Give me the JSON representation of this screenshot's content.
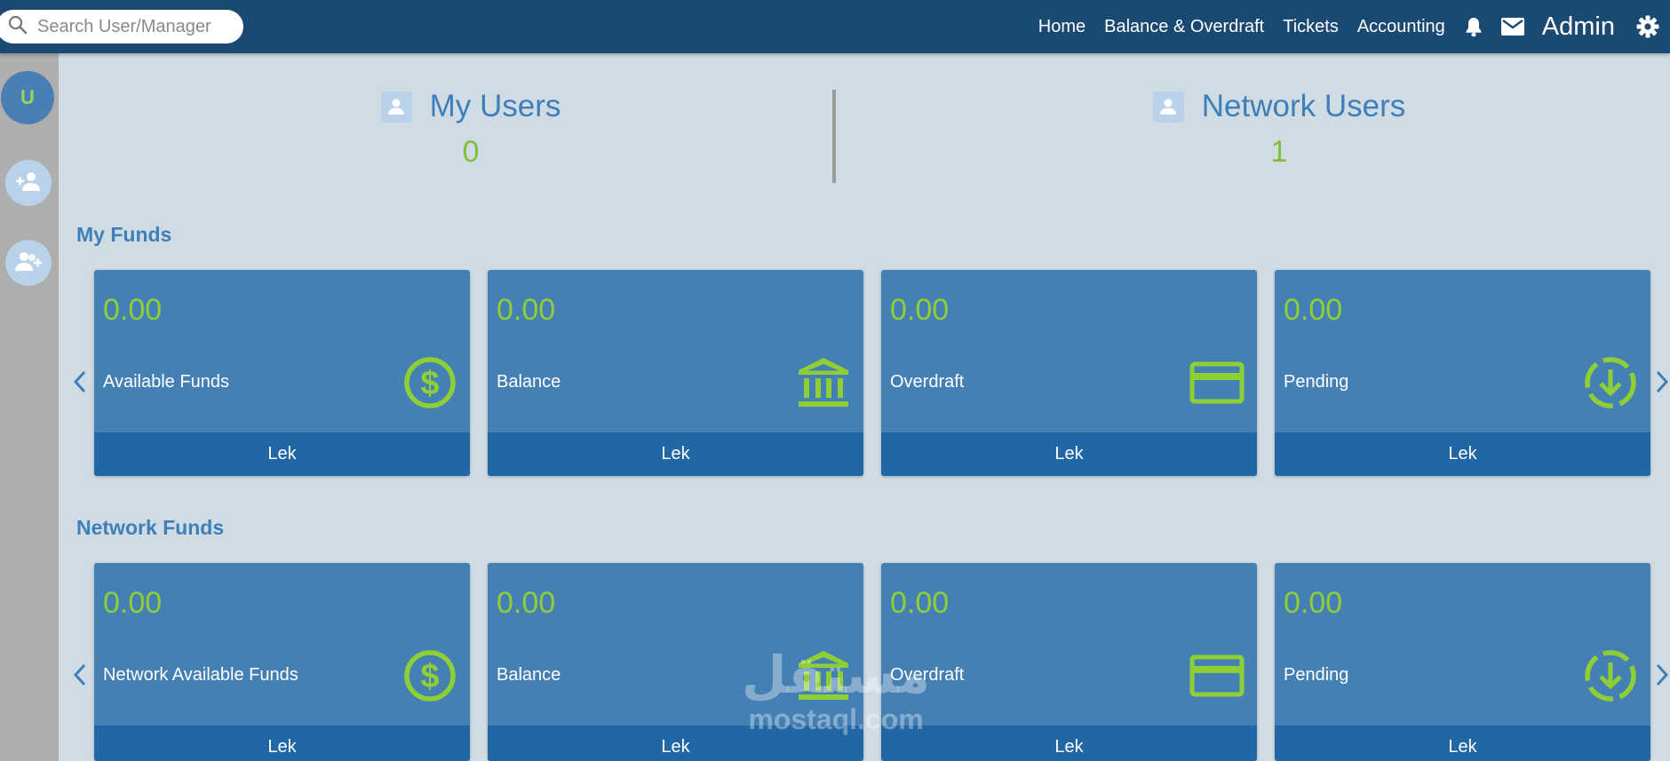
{
  "header": {
    "search": {
      "placeholder": "Search User/Manager",
      "icon": "search-icon"
    },
    "nav": [
      "Home",
      "Balance & Overdraft",
      "Tickets",
      "Accounting"
    ],
    "user": "Admin",
    "icons": {
      "notifications": "bell-icon",
      "messages": "mail-icon",
      "settings": "gear-icon"
    }
  },
  "sidebar": {
    "avatar_letter": "U",
    "items": [
      {
        "icon": "add-user-icon"
      },
      {
        "icon": "add-users-icon"
      }
    ]
  },
  "stats": {
    "my_users": {
      "label": "My Users",
      "value": "0"
    },
    "network_users": {
      "label": "Network Users",
      "value": "1"
    }
  },
  "sections": [
    {
      "title": "My Funds",
      "cards": [
        {
          "value": "0.00",
          "label": "Available Funds",
          "currency": "Lek",
          "icon": "dollar-icon"
        },
        {
          "value": "0.00",
          "label": "Balance",
          "currency": "Lek",
          "icon": "bank-icon"
        },
        {
          "value": "0.00",
          "label": "Overdraft",
          "currency": "Lek",
          "icon": "credit-card-icon"
        },
        {
          "value": "0.00",
          "label": "Pending",
          "currency": "Lek",
          "icon": "pending-download-icon"
        }
      ]
    },
    {
      "title": "Network Funds",
      "cards": [
        {
          "value": "0.00",
          "label": "Network Available Funds",
          "currency": "Lek",
          "icon": "dollar-icon"
        },
        {
          "value": "0.00",
          "label": "Balance",
          "currency": "Lek",
          "icon": "bank-icon"
        },
        {
          "value": "0.00",
          "label": "Overdraft",
          "currency": "Lek",
          "icon": "credit-card-icon"
        },
        {
          "value": "0.00",
          "label": "Pending",
          "currency": "Lek",
          "icon": "pending-download-icon"
        }
      ]
    }
  ],
  "watermark": {
    "arabic": "مستقل",
    "latin": "mostaql.com"
  },
  "colors": {
    "topbar": "#1a4a72",
    "background": "#cfdce4",
    "card": "#4580b4",
    "card_footer": "#2166a5",
    "accent_green": "#8fcf36",
    "title_blue": "#3f7fb9"
  }
}
